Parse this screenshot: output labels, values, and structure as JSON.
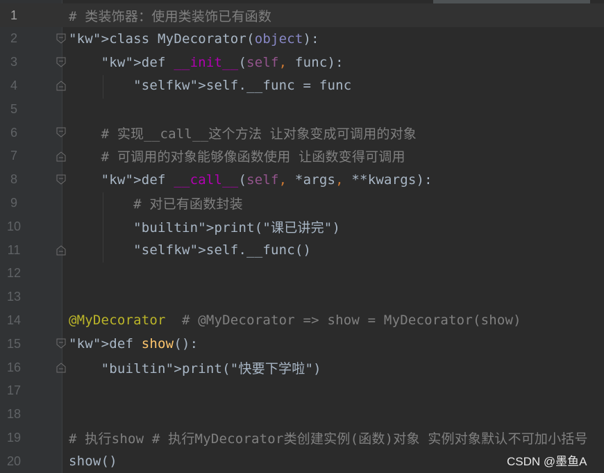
{
  "editor": {
    "line_numbers": [
      "1",
      "2",
      "3",
      "4",
      "5",
      "6",
      "7",
      "8",
      "9",
      "10",
      "11",
      "12",
      "13",
      "14",
      "15",
      "16",
      "17",
      "18",
      "19",
      "20"
    ],
    "code": [
      {
        "text": "# 类装饰器：使用类装饰已有函数"
      },
      {
        "text": "class MyDecorator(object):"
      },
      {
        "text": "    def __init__(self, func):"
      },
      {
        "text": "        self.__func = func"
      },
      {
        "text": ""
      },
      {
        "text": "    # 实现__call__这个方法 让对象变成可调用的对象"
      },
      {
        "text": "    # 可调用的对象能够像函数使用 让函数变得可调用"
      },
      {
        "text": "    def __call__(self, *args, **kwargs):"
      },
      {
        "text": "        # 对已有函数封装"
      },
      {
        "text": "        print(\"课已讲完\")"
      },
      {
        "text": "        self.__func()"
      },
      {
        "text": ""
      },
      {
        "text": ""
      },
      {
        "text": "@MyDecorator  # @MyDecorator => show = MyDecorator(show)"
      },
      {
        "text": "def show():"
      },
      {
        "text": "    print(\"快要下学啦\")"
      },
      {
        "text": ""
      },
      {
        "text": ""
      },
      {
        "text": "# 执行show # 执行MyDecorator类创建实例(函数)对象 实例对象默认不可加小括号"
      },
      {
        "text": "show()"
      }
    ]
  },
  "watermark": "CSDN @墨鱼A",
  "colors": {
    "background": "#2b2b2b",
    "keyword": "#cc7832",
    "comment": "#808080",
    "function": "#ffc66d",
    "string": "#6a8759",
    "decorator": "#bbb529"
  }
}
